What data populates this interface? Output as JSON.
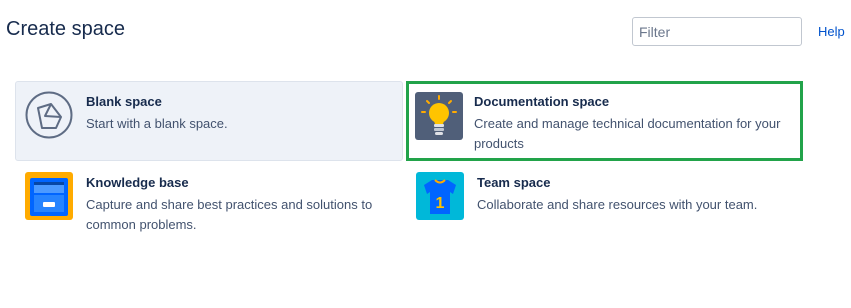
{
  "header": {
    "title": "Create space",
    "filter_placeholder": "Filter",
    "help_label": "Help"
  },
  "spaces": [
    {
      "name": "Blank space",
      "description": "Start with a blank space.",
      "icon": "blank-space-icon"
    },
    {
      "name": "Documentation space",
      "description": "Create and manage technical documentation for your products",
      "icon": "lightbulb-icon"
    },
    {
      "name": "Knowledge base",
      "description": "Capture and share best practices and solutions to common problems.",
      "icon": "file-cabinet-icon"
    },
    {
      "name": "Team space",
      "description": "Collaborate and share resources with your team.",
      "icon": "team-jersey-icon"
    }
  ],
  "colors": {
    "selected_bg": "#eef2f8",
    "highlight_border": "#22a34a",
    "link": "#0052cc"
  }
}
